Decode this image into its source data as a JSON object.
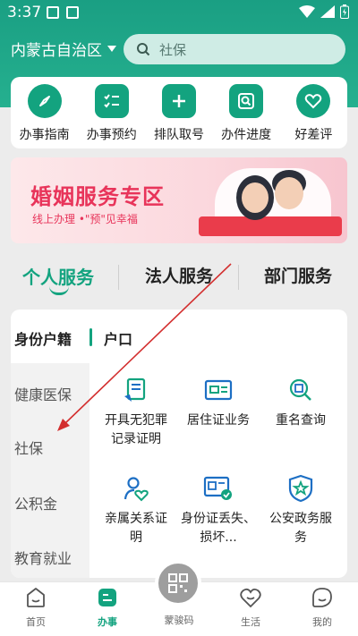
{
  "status_bar": {
    "time": "3:37"
  },
  "header": {
    "region": "内蒙古自治区",
    "search_placeholder": "社保"
  },
  "quick_actions": [
    {
      "label": "办事指南",
      "icon": "compass-icon"
    },
    {
      "label": "办事预约",
      "icon": "checklist-icon"
    },
    {
      "label": "排队取号",
      "icon": "plus-icon"
    },
    {
      "label": "办件进度",
      "icon": "progress-search-icon"
    },
    {
      "label": "好差评",
      "icon": "heart-rating-icon"
    }
  ],
  "banner": {
    "title": "婚姻服务专区",
    "subtitle": "线上办理 •\"预\"见幸福"
  },
  "service_tabs": [
    {
      "label": "个人服务",
      "active": true
    },
    {
      "label": "法人服务",
      "active": false
    },
    {
      "label": "部门服务",
      "active": false
    }
  ],
  "content": {
    "category": "身份户籍",
    "subcategory": "户口",
    "sidebar_items": [
      "健康医保",
      "社保",
      "公积金",
      "教育就业"
    ],
    "services": [
      {
        "label": "开具无犯罪记录证明",
        "icon": "certificate-icon"
      },
      {
        "label": "居住证业务",
        "icon": "id-card-icon"
      },
      {
        "label": "重名查询",
        "icon": "name-search-icon"
      },
      {
        "label": "亲属关系证明",
        "icon": "relation-heart-icon"
      },
      {
        "label": "身份证丢失、损坏...",
        "icon": "id-card-check-icon"
      },
      {
        "label": "公安政务服务",
        "icon": "police-shield-icon"
      }
    ]
  },
  "bottom_nav": [
    {
      "label": "首页",
      "icon": "home-icon",
      "active": false
    },
    {
      "label": "办事",
      "icon": "service-icon",
      "active": true
    },
    {
      "label": "蒙骏码",
      "icon": "qr-code-icon",
      "active": false
    },
    {
      "label": "生活",
      "icon": "life-heart-icon",
      "active": false
    },
    {
      "label": "我的",
      "icon": "profile-icon",
      "active": false
    }
  ],
  "colors": {
    "accent": "#13a37f",
    "header": "#1a9f83",
    "banner_text": "#e8345a",
    "annotation_arrow": "#d32f2f"
  }
}
